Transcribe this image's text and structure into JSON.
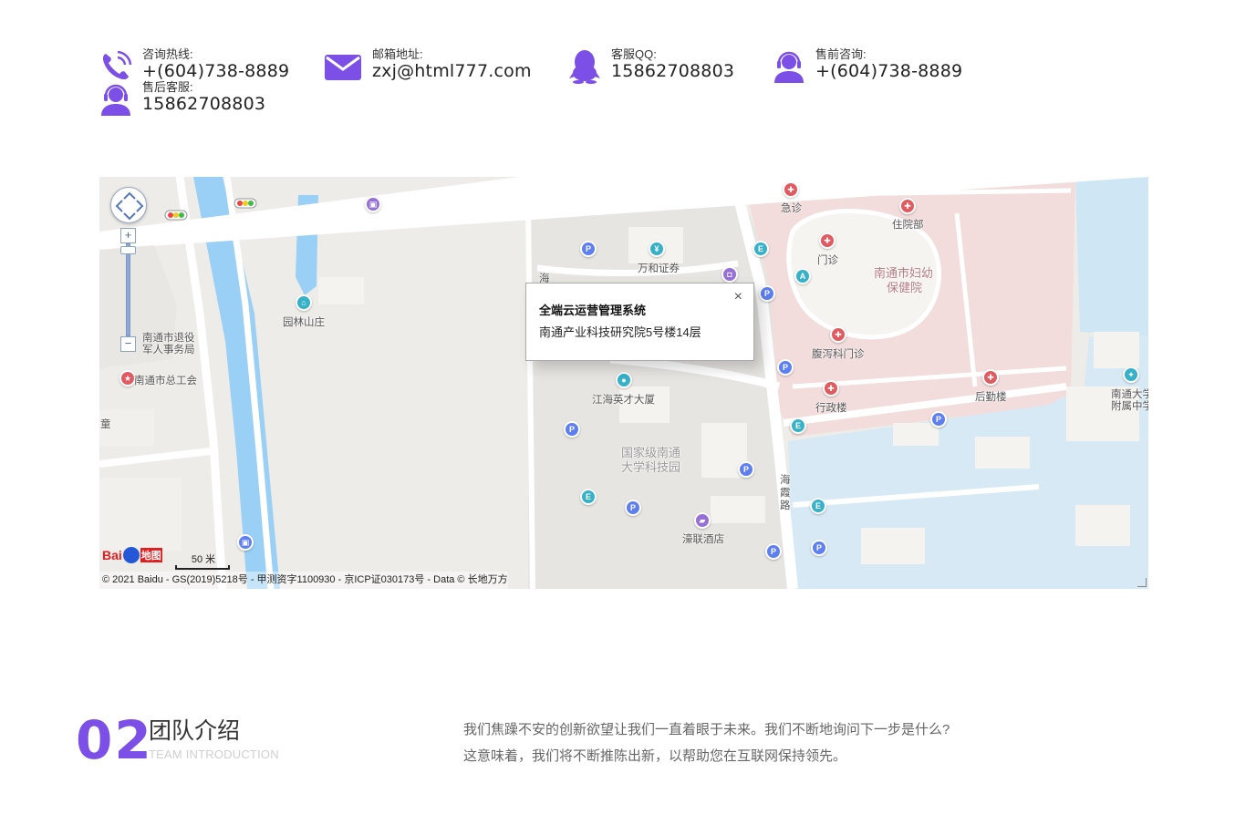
{
  "contacts": [
    {
      "label": "咨询热线:",
      "value": "+(604)738-8889",
      "icon": "phone-icon"
    },
    {
      "label": "邮箱地址:",
      "value": "zxj@html777.com",
      "icon": "envelope-icon"
    },
    {
      "label": "客服QQ:",
      "value": "15862708803",
      "icon": "qq-penguin-icon"
    },
    {
      "label": "售前咨询:",
      "value": "+(604)738-8889",
      "icon": "headset-agent-icon"
    },
    {
      "label": "售后客服:",
      "value": "15862708803",
      "icon": "headset-agent-icon"
    }
  ],
  "colors": {
    "accent": "#7c4fe6",
    "water": "#9ad0f5",
    "hospital_area": "#f2dcdc"
  },
  "map": {
    "infowindow": {
      "title": "全端云运营管理系统",
      "address": "南通产业科技研究院5号楼14层",
      "close": "×"
    },
    "labels": {
      "yuanlin": "园林山庄",
      "tuiyi_1": "南通市退役",
      "tuiyi_2": "军人事务局",
      "zonggonghui": "南通市总工会",
      "tong": "童",
      "wanhe": "万和证券",
      "hai_top": "海",
      "jianghai": "江海英才大厦",
      "kejiyuan_1": "国家级南通",
      "kejiyuan_2": "大学科技园",
      "haoliang": "濠联酒店",
      "haixia_1": "海",
      "haixia_2": "霞",
      "haixia_3": "路",
      "jizhen": "急诊",
      "zhuyuanbu": "住院部",
      "menzhen": "门诊",
      "fuyou_1": "南通市妇幼",
      "fuyou_2": "保健院",
      "fuxie": "腹泻科门诊",
      "xingzheng": "行政楼",
      "houqin": "后勤楼",
      "fushu_1": "南通大学",
      "fushu_2": "附属中学"
    },
    "zoom_plus": "+",
    "zoom_minus": "−",
    "scale": "50 米",
    "logo_text_1": "Bai",
    "logo_text_2": "地图",
    "copyright": "© 2021 Baidu - GS(2019)5218号 - 甲测资字1100930 - 京ICP证030173号 - Data © 长地万方"
  },
  "section": {
    "number": "02",
    "title": "团队介绍",
    "subtitle": "TEAM INTRODUCTION",
    "desc_line1": "我们焦躁不安的创新欲望让我们一直着眼于未来。我们不断地询问下一步是什么?",
    "desc_line2": "这意味着，我们将不断推陈出新，以帮助您在互联网保持领先。"
  }
}
